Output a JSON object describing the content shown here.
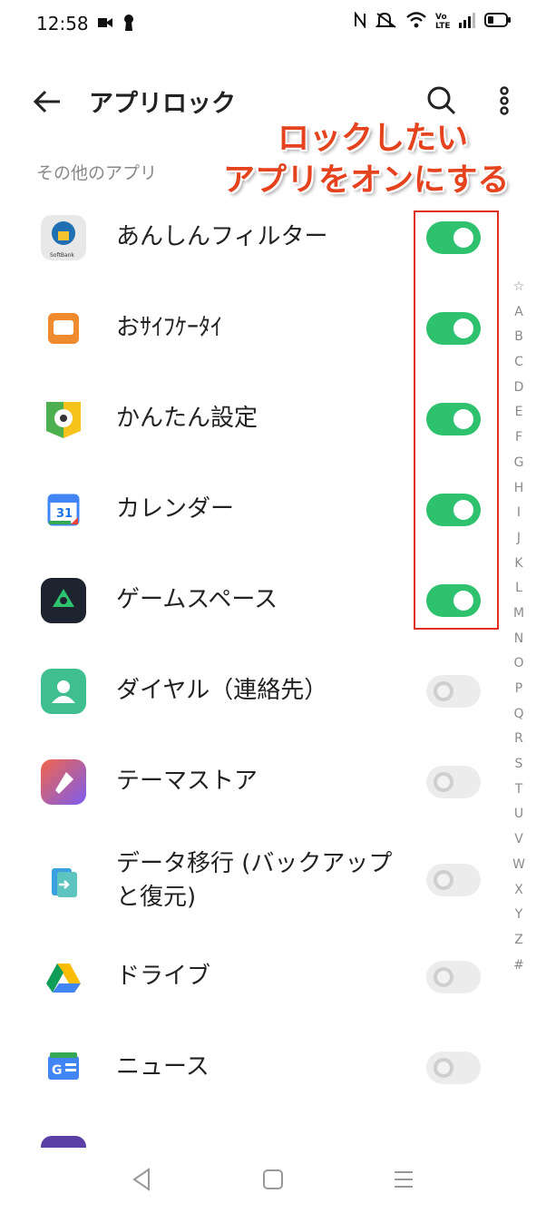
{
  "status": {
    "time": "12:58"
  },
  "header": {
    "title": "アプリロック"
  },
  "annotation": {
    "line1": "ロックしたい",
    "line2": "アプリをオンにする"
  },
  "section": {
    "title": "その他のアプリ"
  },
  "apps": [
    {
      "label": "あんしんフィルター",
      "enabled": true,
      "icon": "safety-filter-icon"
    },
    {
      "label": "おｻｲﾌｹｰﾀｲ",
      "enabled": true,
      "icon": "osaifu-keitai-icon"
    },
    {
      "label": "かんたん設定",
      "enabled": true,
      "icon": "easy-settings-icon"
    },
    {
      "label": "カレンダー",
      "enabled": true,
      "icon": "calendar-icon"
    },
    {
      "label": "ゲームスペース",
      "enabled": true,
      "icon": "game-space-icon"
    },
    {
      "label": "ダイヤル（連絡先）",
      "enabled": false,
      "icon": "contacts-icon"
    },
    {
      "label": "テーマストア",
      "enabled": false,
      "icon": "theme-store-icon"
    },
    {
      "label": "データ移行 (バックアップ",
      "label2": "と復元)",
      "enabled": false,
      "icon": "data-transfer-icon"
    },
    {
      "label": "ドライブ",
      "enabled": false,
      "icon": "drive-icon"
    },
    {
      "label": "ニュース",
      "enabled": false,
      "icon": "news-icon"
    }
  ],
  "alphabet": [
    "☆",
    "A",
    "B",
    "C",
    "D",
    "E",
    "F",
    "G",
    "H",
    "I",
    "J",
    "K",
    "L",
    "M",
    "N",
    "O",
    "P",
    "Q",
    "R",
    "S",
    "T",
    "U",
    "V",
    "W",
    "X",
    "Y",
    "Z",
    "#"
  ],
  "colors": {
    "toggle_on": "#2ec26f",
    "annotation": "#e5421e",
    "highlight_box": "#e0301e"
  }
}
